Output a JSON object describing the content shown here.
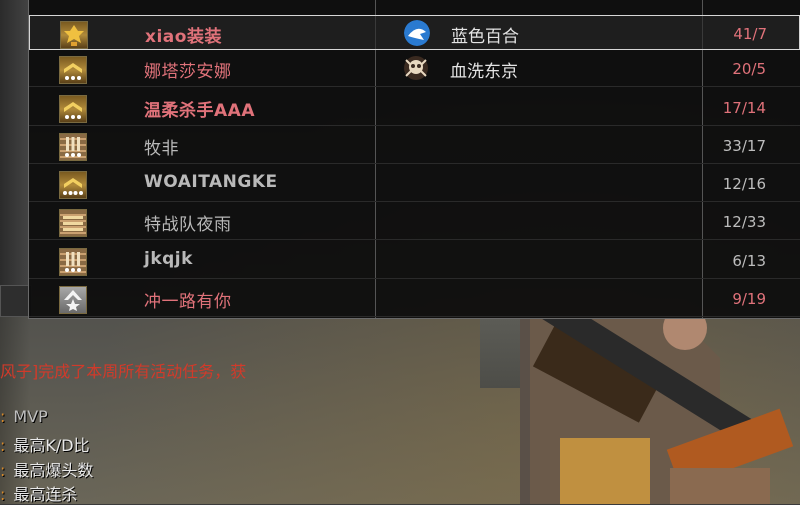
{
  "scoreboard": {
    "rows": [
      {
        "rank_icon": "gold-crest-rank-icon",
        "name": "xiao装装",
        "clan_icon": "white-shark-clan-icon",
        "clan": "蓝色百合",
        "kd": "41/7",
        "self": true
      },
      {
        "rank_icon": "gold-chevron-three-stars-rank-icon",
        "name": "娜塔莎安娜",
        "clan_icon": "skull-crest-clan-icon",
        "clan": "血洗东京",
        "kd": "20/5",
        "self": false
      },
      {
        "rank_icon": "gold-chevron-three-stars-rank-icon",
        "name": "温柔杀手AAA",
        "clan_icon": "",
        "clan": "",
        "kd": "17/14",
        "self": false
      },
      {
        "rank_icon": "bars-three-stars-rank-icon",
        "name": "牧非",
        "clan_icon": "",
        "clan": "",
        "kd": "33/17",
        "self": false
      },
      {
        "rank_icon": "gold-chevron-four-stars-rank-icon",
        "name": "WOAITANGKE",
        "clan_icon": "",
        "clan": "",
        "kd": "12/16",
        "self": false
      },
      {
        "rank_icon": "bronze-bars-rank-icon",
        "name": "特战队夜雨",
        "clan_icon": "",
        "clan": "",
        "kd": "12/33",
        "self": false
      },
      {
        "rank_icon": "bars-three-stars-rank-icon",
        "name": "jkqjk",
        "clan_icon": "",
        "clan": "",
        "kd": "6/13",
        "self": false
      },
      {
        "rank_icon": "silver-star-chevron-rank-icon",
        "name": "冲一路有你",
        "clan_icon": "",
        "clan": "",
        "kd": "9/19",
        "self": false
      }
    ]
  },
  "chat": {
    "message": "风子]完成了本周所有活动任务，获",
    "awards": [
      {
        "label": "MVP"
      },
      {
        "label": "最高K/D比"
      },
      {
        "label": "最高爆头数"
      },
      {
        "label": "最高连杀"
      }
    ]
  },
  "colors": {
    "enemy_name": "#e0727a",
    "neutral_name": "#b9b9b9",
    "chat_system": "#d23a2a"
  }
}
